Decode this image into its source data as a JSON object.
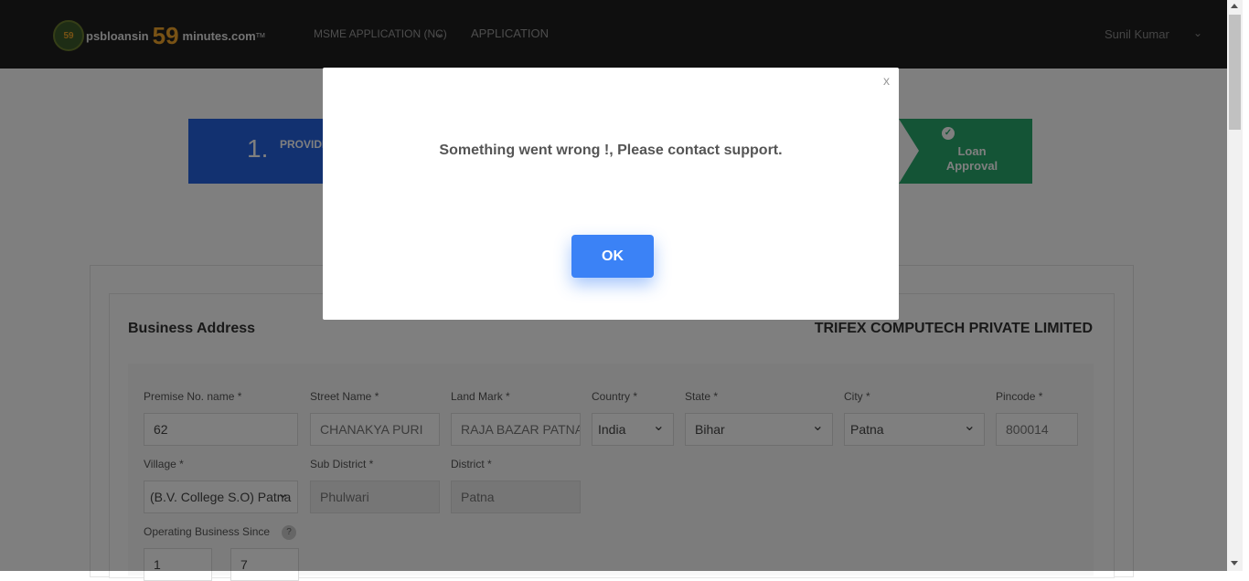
{
  "header": {
    "logo_badge": "59",
    "logo_text_left": "psbloansin",
    "logo_number": "59",
    "logo_text_right": "minutes.com",
    "logo_tm": "TM",
    "nav_items": [
      "MSME APPLICATION (NC)",
      "APPLICATION"
    ],
    "user_name": "Sunil Kumar"
  },
  "stepper": {
    "step1_number": "1.",
    "step1_text": "PROVIDE YOUR DETAILS",
    "final_step_label": "Loan Approval"
  },
  "section": {
    "title": "Business Address",
    "company_name": "TRIFEX COMPUTECH PRIVATE LIMITED"
  },
  "form": {
    "premise_label": "Premise No. name *",
    "premise_value": "62",
    "street_label": "Street Name *",
    "street_value": "CHANAKYA PURI",
    "landmark_label": "Land Mark *",
    "landmark_value": "RAJA BAZAR PATNA",
    "country_label": "Country *",
    "country_value": "India",
    "state_label": "State *",
    "state_value": "Bihar",
    "city_label": "City *",
    "city_value": "Patna",
    "pincode_label": "Pincode *",
    "pincode_value": "800014",
    "village_label": "Village *",
    "village_value": "(B.V. College S.O) Patna",
    "subdistrict_label": "Sub District *",
    "subdistrict_value": "Phulwari",
    "district_label": "District *",
    "district_value": "Patna",
    "operating_label": "Operating Business Since",
    "operating_help": "?",
    "operating_years": "1",
    "operating_months": "7"
  },
  "modal": {
    "close_label": "x",
    "message": "Something went wrong !, Please contact support.",
    "ok_label": "OK"
  }
}
